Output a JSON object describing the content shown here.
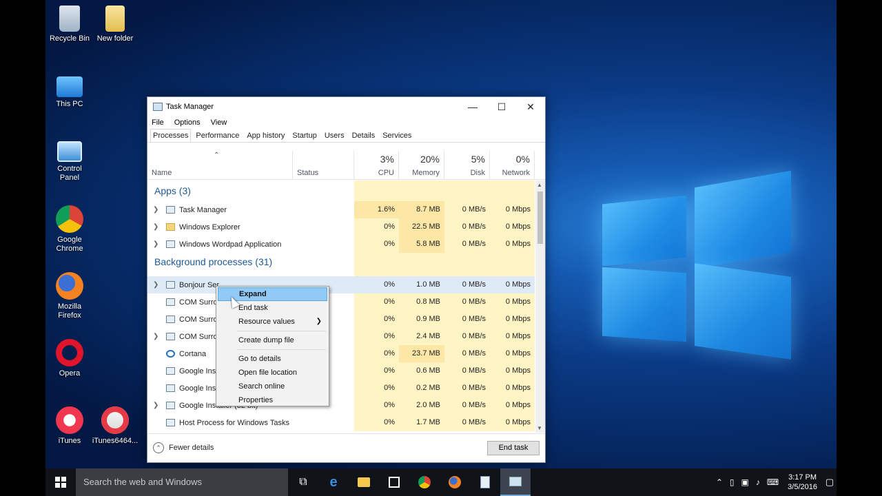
{
  "desktop_icons": [
    {
      "label": "Recycle Bin",
      "icon": "recycle-bin-icon"
    },
    {
      "label": "New folder",
      "icon": "folder-icon"
    },
    {
      "label": "This PC",
      "icon": "computer-icon"
    },
    {
      "label": "Control\nPanel",
      "icon": "control-panel-icon"
    },
    {
      "label": "Google\nChrome",
      "icon": "chrome-icon"
    },
    {
      "label": "Mozilla\nFirefox",
      "icon": "firefox-icon"
    },
    {
      "label": "Opera",
      "icon": "opera-icon"
    },
    {
      "label": "iTunes",
      "icon": "itunes-icon"
    },
    {
      "label": "iTunes6464...",
      "icon": "installer-icon"
    }
  ],
  "window": {
    "title": "Task Manager",
    "menu": [
      "File",
      "Options",
      "View"
    ],
    "tabs": [
      "Processes",
      "Performance",
      "App history",
      "Startup",
      "Users",
      "Details",
      "Services"
    ],
    "active_tab": "Processes"
  },
  "columns": {
    "name": "Name",
    "status": "Status",
    "cpu": {
      "pct": "3%",
      "label": "CPU"
    },
    "memory": {
      "pct": "20%",
      "label": "Memory"
    },
    "disk": {
      "pct": "5%",
      "label": "Disk"
    },
    "network": {
      "pct": "0%",
      "label": "Network"
    }
  },
  "groups": {
    "apps": "Apps (3)",
    "background": "Background processes (31)"
  },
  "apps": [
    {
      "name": "Task Manager",
      "cpu": "1.6%",
      "mem": "8.7 MB",
      "disk": "0 MB/s",
      "net": "0 Mbps"
    },
    {
      "name": "Windows Explorer",
      "cpu": "0%",
      "mem": "22.5 MB",
      "disk": "0 MB/s",
      "net": "0 Mbps"
    },
    {
      "name": "Windows Wordpad Application",
      "cpu": "0%",
      "mem": "5.8 MB",
      "disk": "0 MB/s",
      "net": "0 Mbps"
    }
  ],
  "background": [
    {
      "name": "Bonjour Ser",
      "cpu": "0%",
      "mem": "1.0 MB",
      "disk": "0 MB/s",
      "net": "0 Mbps"
    },
    {
      "name": "COM Surro",
      "cpu": "0%",
      "mem": "0.8 MB",
      "disk": "0 MB/s",
      "net": "0 Mbps"
    },
    {
      "name": "COM Surro",
      "cpu": "0%",
      "mem": "0.9 MB",
      "disk": "0 MB/s",
      "net": "0 Mbps"
    },
    {
      "name": "COM Surro",
      "cpu": "0%",
      "mem": "2.4 MB",
      "disk": "0 MB/s",
      "net": "0 Mbps"
    },
    {
      "name": "Cortana",
      "cpu": "0%",
      "mem": "23.7 MB",
      "disk": "0 MB/s",
      "net": "0 Mbps"
    },
    {
      "name": "Google Inst",
      "cpu": "0%",
      "mem": "0.6 MB",
      "disk": "0 MB/s",
      "net": "0 Mbps"
    },
    {
      "name": "Google Inst",
      "cpu": "0%",
      "mem": "0.2 MB",
      "disk": "0 MB/s",
      "net": "0 Mbps"
    },
    {
      "name": "Google Installer (32 bit)",
      "cpu": "0%",
      "mem": "2.0 MB",
      "disk": "0 MB/s",
      "net": "0 Mbps"
    },
    {
      "name": "Host Process for Windows Tasks",
      "cpu": "0%",
      "mem": "1.7 MB",
      "disk": "0 MB/s",
      "net": "0 Mbps"
    }
  ],
  "footer": {
    "fewer_details": "Fewer details",
    "end_task": "End task"
  },
  "context_menu": {
    "expand": "Expand",
    "end_task": "End task",
    "resource_values": "Resource values",
    "create_dump": "Create dump file",
    "go_to_details": "Go to details",
    "open_file_location": "Open file location",
    "search_online": "Search online",
    "properties": "Properties"
  },
  "taskbar": {
    "search_placeholder": "Search the web and Windows",
    "time": "3:17 PM",
    "date": "3/5/2016"
  }
}
